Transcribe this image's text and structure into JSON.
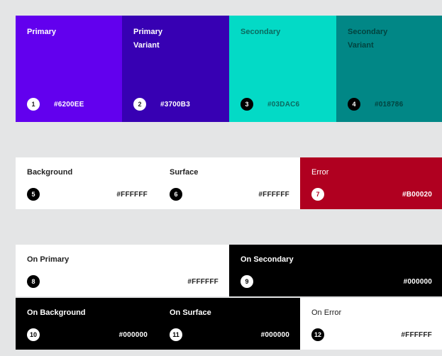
{
  "primary_row": [
    {
      "name": "Primary",
      "number": "1",
      "hex": "#6200EE",
      "color": "#6200ee",
      "text": "#ffffff"
    },
    {
      "name": "Primary\nVariant",
      "number": "2",
      "hex": "#3700B3",
      "color": "#3700b3",
      "text": "#ffffff"
    },
    {
      "name": "Secondary",
      "number": "3",
      "hex": "#03DAC6",
      "color": "#03dac6",
      "text": "#000000"
    },
    {
      "name": "Secondary\nVariant",
      "number": "4",
      "hex": "#018786",
      "color": "#018786",
      "text": "#000000"
    }
  ],
  "surface_row": [
    {
      "name": "Background",
      "number": "5",
      "hex": "#FFFFFF",
      "color": "#ffffff",
      "text": "#000000"
    },
    {
      "name": "Surface",
      "number": "6",
      "hex": "#FFFFFF",
      "color": "#ffffff",
      "text": "#000000"
    },
    {
      "name": "Error",
      "number": "7",
      "hex": "#B00020",
      "color": "#b00020",
      "text": "#ffffff"
    }
  ],
  "on_row_1": [
    {
      "name": "On Primary",
      "number": "8",
      "hex": "#FFFFFF",
      "color": "#ffffff",
      "text": "#000000"
    },
    {
      "name": "On Secondary",
      "number": "9",
      "hex": "#000000",
      "color": "#000000",
      "text": "#ffffff"
    }
  ],
  "on_row_2": [
    {
      "name": "On Background",
      "number": "10",
      "hex": "#000000",
      "color": "#000000",
      "text": "#ffffff"
    },
    {
      "name": "On Surface",
      "number": "11",
      "hex": "#000000",
      "color": "#000000",
      "text": "#ffffff"
    },
    {
      "name": "On Error",
      "number": "12",
      "hex": "#FFFFFF",
      "color": "#ffffff",
      "text": "#000000"
    }
  ]
}
